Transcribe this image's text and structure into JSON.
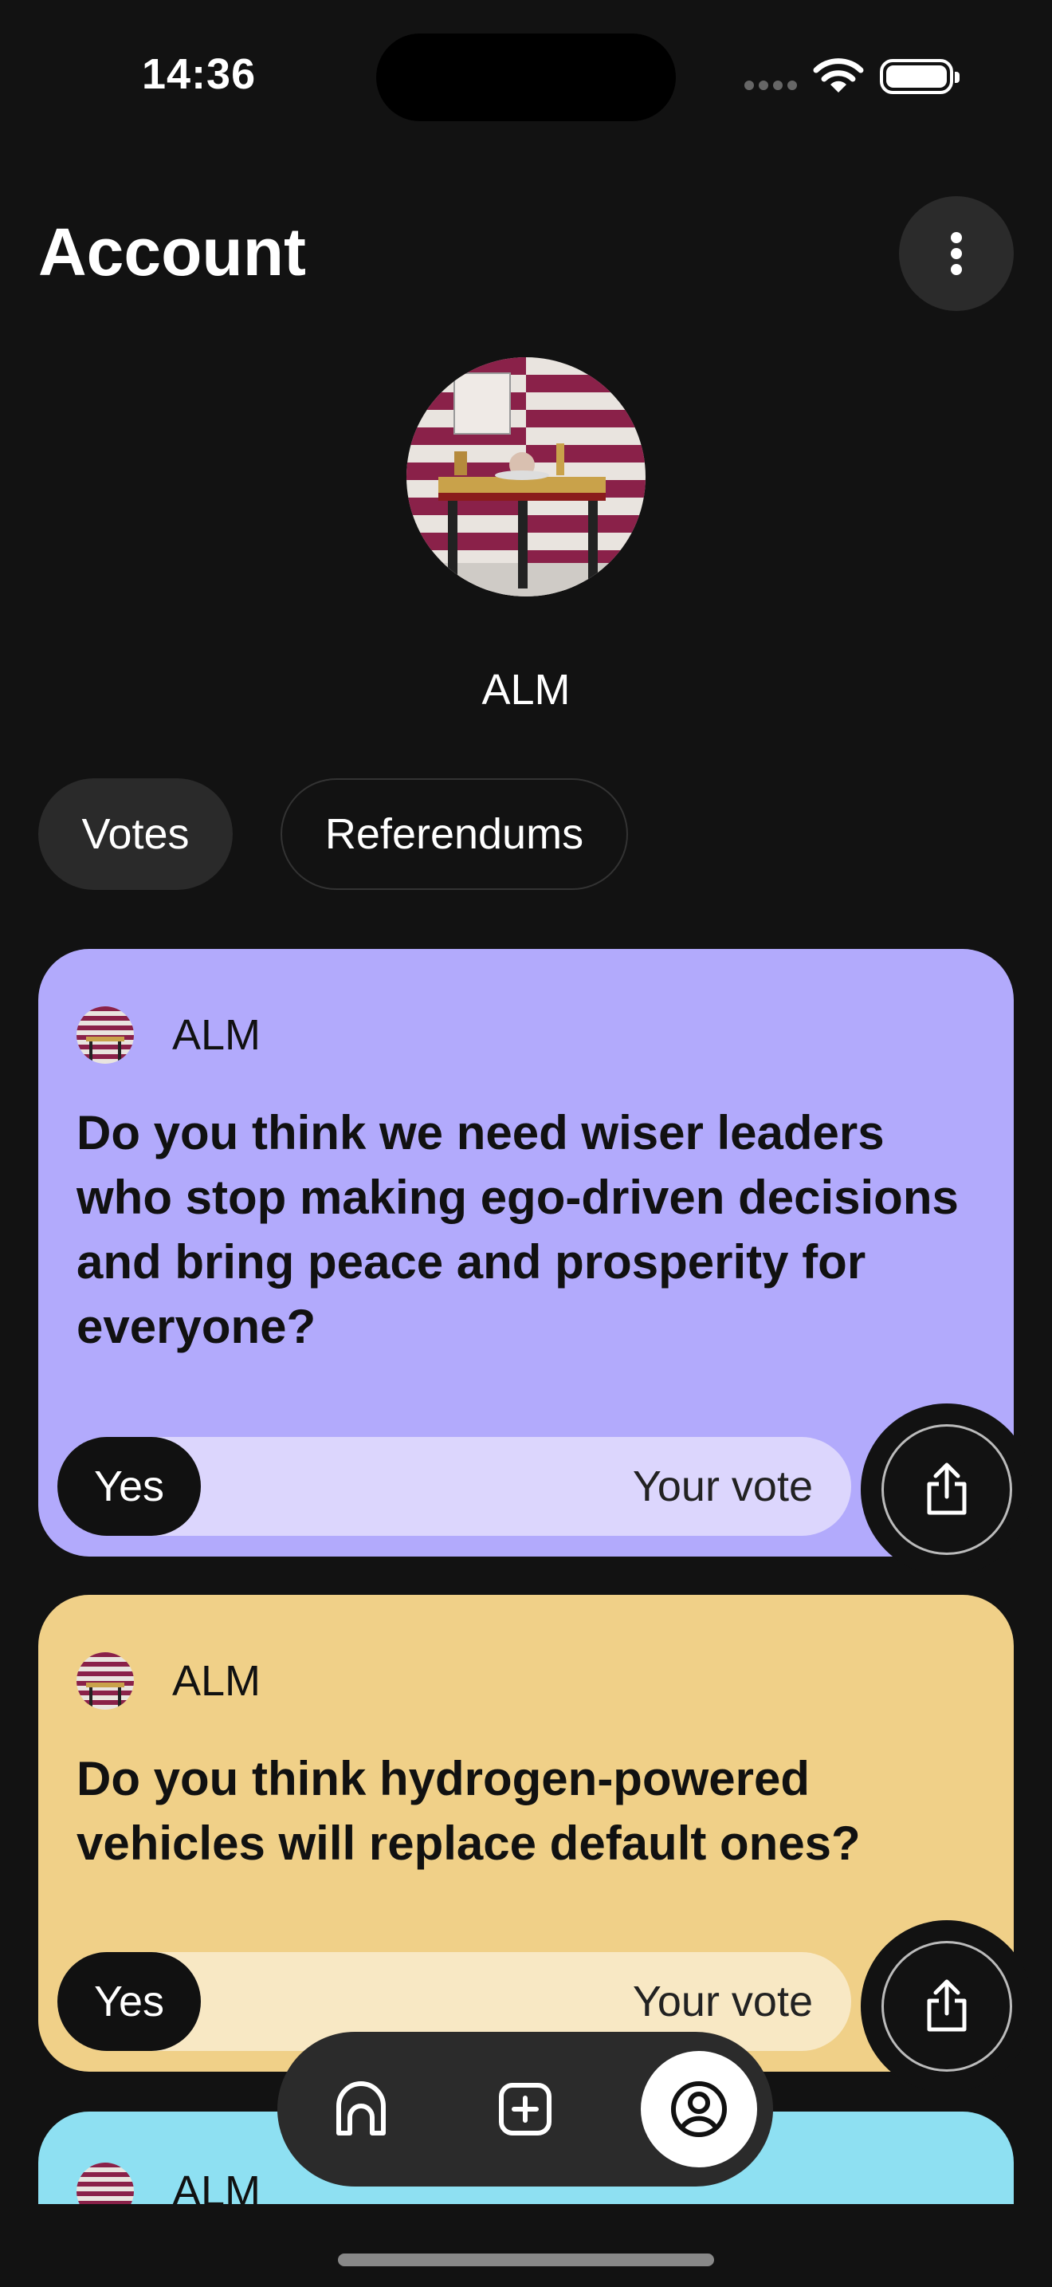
{
  "status": {
    "time": "14:36"
  },
  "header": {
    "title": "Account"
  },
  "profile": {
    "name": "ALM"
  },
  "tabs": [
    {
      "label": "Votes",
      "active": true
    },
    {
      "label": "Referendums",
      "active": false
    }
  ],
  "cards": [
    {
      "author": "ALM",
      "question": "Do you think we need wiser leaders who stop making ego-driven decisions and bring peace and prosperity for everyone?",
      "vote": "Yes",
      "vote_caption": "Your vote",
      "color": "#b2aafc",
      "bar_color": "#dcd6fd"
    },
    {
      "author": "ALM",
      "question": "Do you think hydrogen-powered vehicles will replace default ones?",
      "vote": "Yes",
      "vote_caption": "Your vote",
      "color": "#f0d088",
      "bar_color": "#f8e8c4"
    },
    {
      "author": "ALM",
      "color": "#8ee0f2"
    }
  ],
  "nav": {
    "items": [
      {
        "icon": "home-icon",
        "active": false
      },
      {
        "icon": "add-icon",
        "active": false
      },
      {
        "icon": "profile-icon",
        "active": true
      }
    ]
  }
}
